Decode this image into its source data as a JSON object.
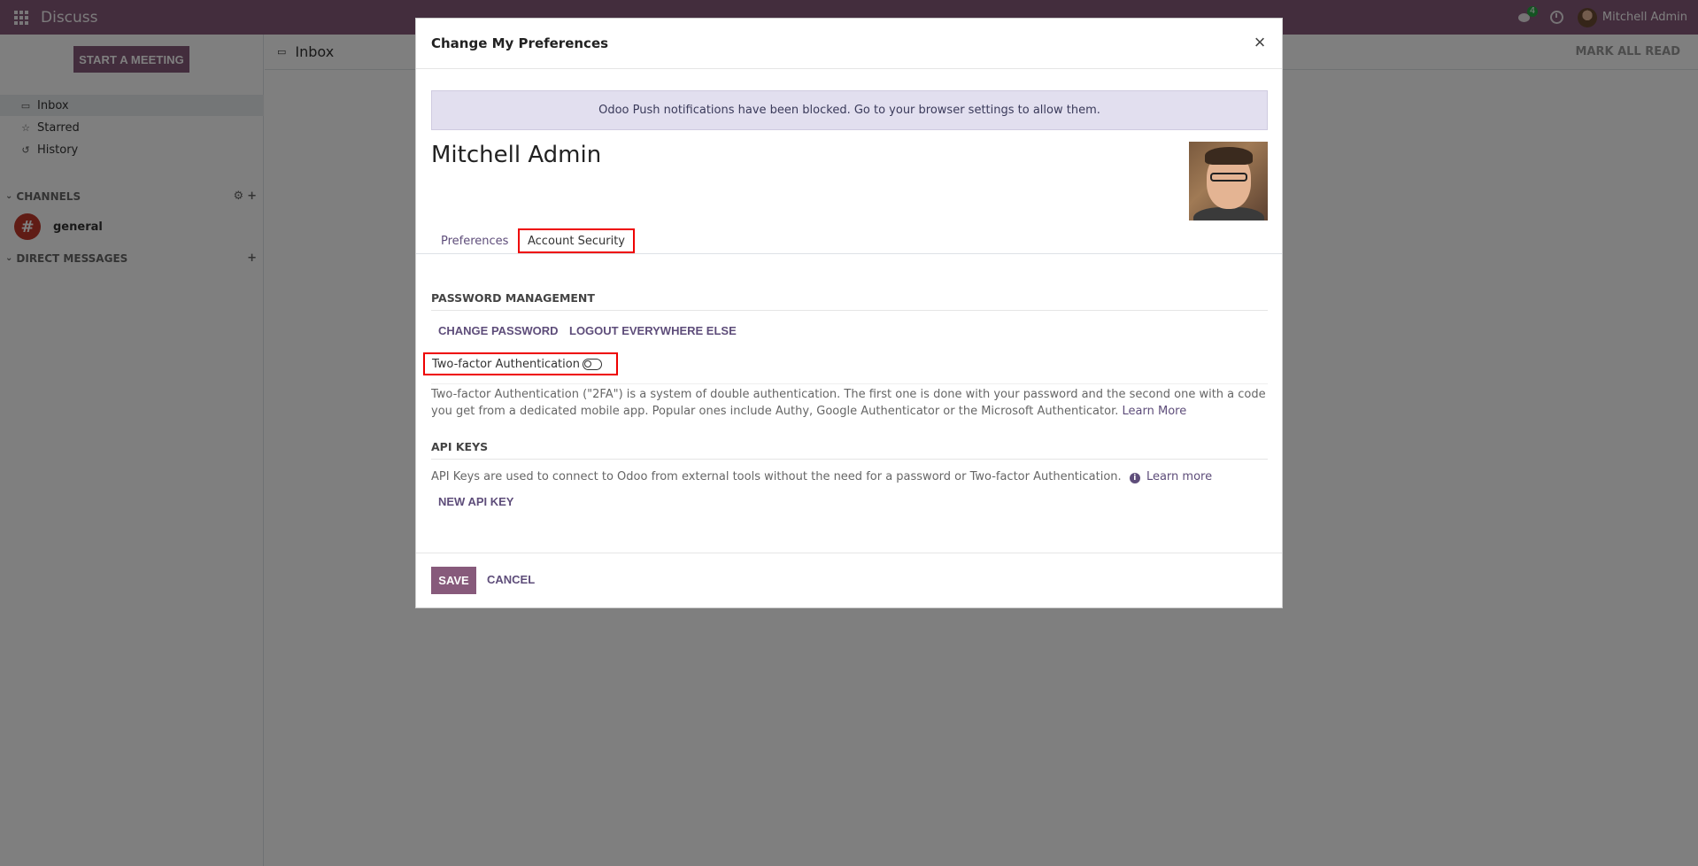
{
  "navbar": {
    "app_name": "Discuss",
    "message_count": "4",
    "user_name": "Mitchell Admin"
  },
  "sidebar": {
    "start_meeting": "START A MEETING",
    "items": [
      {
        "label": "Inbox",
        "icon": "inbox-icon"
      },
      {
        "label": "Starred",
        "icon": "star-icon"
      },
      {
        "label": "History",
        "icon": "history-icon"
      }
    ],
    "channels_header": "CHANNELS",
    "channels": [
      {
        "name": "general"
      }
    ],
    "dm_header": "DIRECT MESSAGES"
  },
  "main": {
    "title": "Inbox",
    "mark_all_read": "MARK ALL READ"
  },
  "modal": {
    "title": "Change My Preferences",
    "alert": "Odoo Push notifications have been blocked. Go to your browser settings to allow them.",
    "user_name": "Mitchell Admin",
    "tabs": [
      {
        "label": "Preferences",
        "active": false
      },
      {
        "label": "Account Security",
        "active": true
      }
    ],
    "password_section": "PASSWORD MANAGEMENT",
    "change_password": "CHANGE PASSWORD",
    "logout_everywhere": "LOGOUT EVERYWHERE ELSE",
    "twofa_label": "Two-factor Authentication",
    "twofa_enabled": false,
    "twofa_desc": "Two-factor Authentication (\"2FA\") is a system of double authentication. The first one is done with your password and the second one with a code you get from a dedicated mobile app. Popular ones include Authy, Google Authenticator or the Microsoft Authenticator.",
    "twofa_learn_more": "Learn More",
    "api_section": "API KEYS",
    "api_desc": "API Keys are used to connect to Odoo from external tools without the need for a password or Two-factor Authentication.",
    "api_learn_more": "Learn more",
    "new_api_key": "NEW API KEY",
    "save": "SAVE",
    "cancel": "CANCEL"
  },
  "colors": {
    "brand": "#875a7b",
    "link": "#5e4d7a",
    "highlight": "#e00000"
  }
}
